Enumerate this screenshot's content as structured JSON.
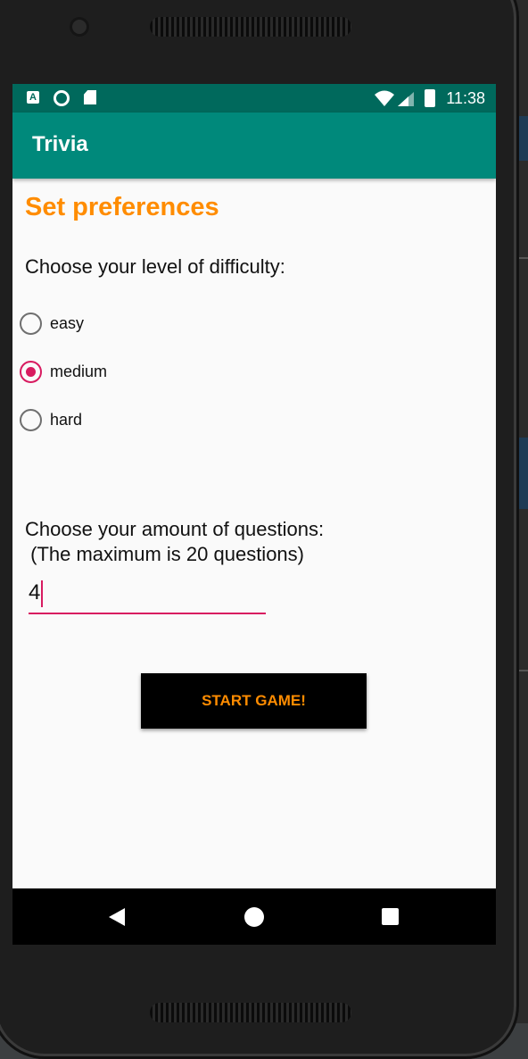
{
  "status_bar": {
    "time": "11:38",
    "icons": [
      "a-notification-icon",
      "sync-circle-icon",
      "sd-card-icon",
      "wifi-icon",
      "signal-icon",
      "battery-charging-icon"
    ]
  },
  "app_bar": {
    "title": "Trivia"
  },
  "preferences": {
    "heading": "Set preferences",
    "difficulty_prompt": "Choose your level of difficulty:",
    "difficulty_options": [
      {
        "label": "easy",
        "checked": false
      },
      {
        "label": "medium",
        "checked": true
      },
      {
        "label": "hard",
        "checked": false
      }
    ],
    "questions_prompt": "Choose your amount of questions:\n (The maximum is 20 questions)",
    "questions_value": "4",
    "start_button": "START GAME!"
  },
  "colors": {
    "status_bar": "#00695c",
    "app_bar": "#00897b",
    "accent": "#ff8c00",
    "radio_selected": "#d81b60"
  }
}
